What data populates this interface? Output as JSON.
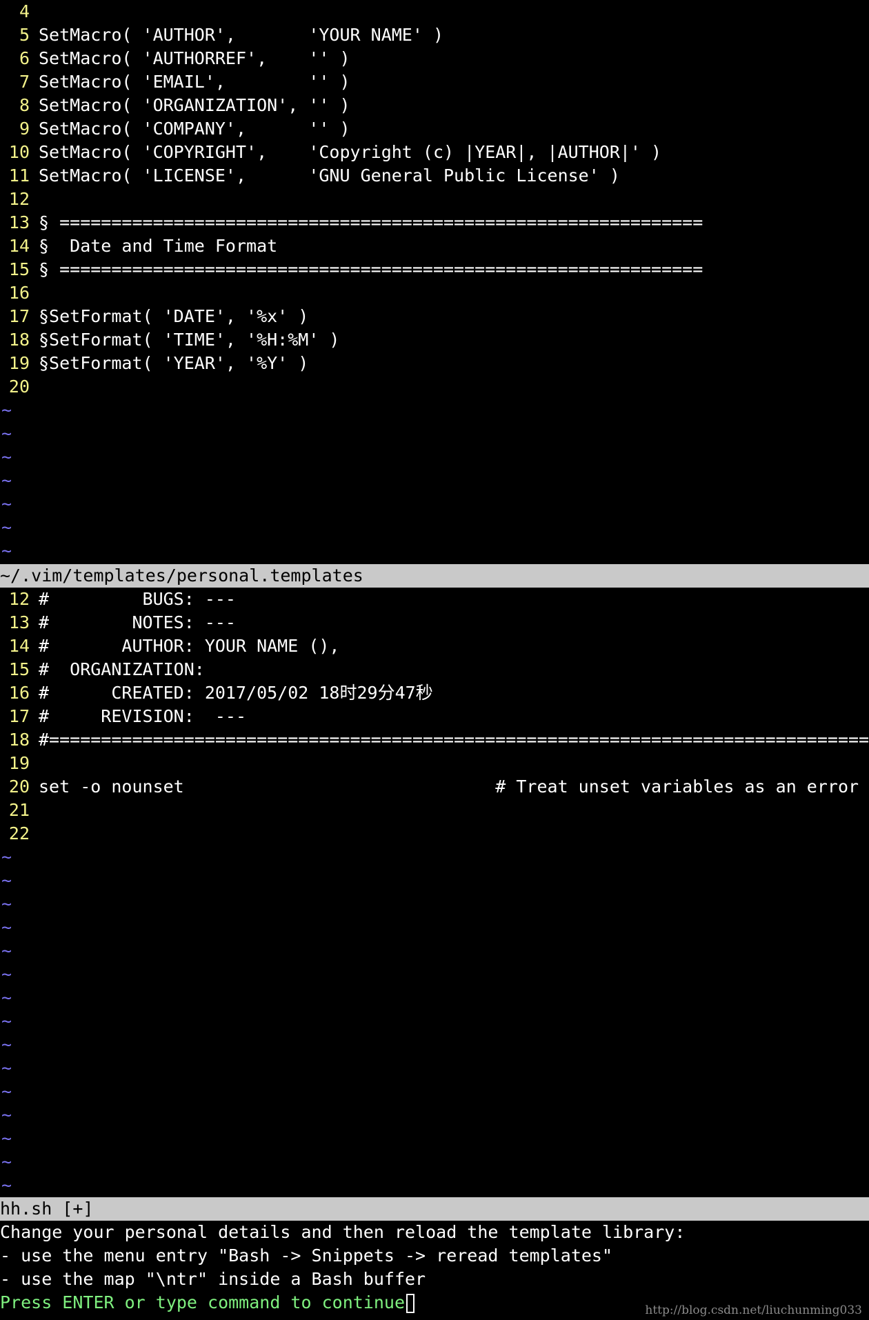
{
  "colors": {
    "background": "#000000",
    "line_number": "#f3f28a",
    "tilde": "#7b73f2",
    "statusline_bg": "#c9c9c9",
    "prompt": "#7ff07f"
  },
  "top_pane": {
    "lines": [
      {
        "num": "4",
        "text": ""
      },
      {
        "num": "5",
        "text": "SetMacro( 'AUTHOR',       'YOUR NAME' )"
      },
      {
        "num": "6",
        "text": "SetMacro( 'AUTHORREF',    '' )"
      },
      {
        "num": "7",
        "text": "SetMacro( 'EMAIL',        '' )"
      },
      {
        "num": "8",
        "text": "SetMacro( 'ORGANIZATION', '' )"
      },
      {
        "num": "9",
        "text": "SetMacro( 'COMPANY',      '' )"
      },
      {
        "num": "10",
        "text": "SetMacro( 'COPYRIGHT',    'Copyright (c) |YEAR|, |AUTHOR|' )"
      },
      {
        "num": "11",
        "text": "SetMacro( 'LICENSE',      'GNU General Public License' )"
      },
      {
        "num": "12",
        "text": ""
      },
      {
        "num": "13",
        "text": "§ =============================================================="
      },
      {
        "num": "14",
        "text": "§  Date and Time Format"
      },
      {
        "num": "15",
        "text": "§ =============================================================="
      },
      {
        "num": "16",
        "text": ""
      },
      {
        "num": "17",
        "text": "§SetFormat( 'DATE', '%x' )"
      },
      {
        "num": "18",
        "text": "§SetFormat( 'TIME', '%H:%M' )"
      },
      {
        "num": "19",
        "text": "§SetFormat( 'YEAR', '%Y' )"
      },
      {
        "num": "20",
        "text": ""
      }
    ],
    "tilde": "~",
    "tilde_count": 7,
    "status": "~/.vim/templates/personal.templates"
  },
  "bottom_pane": {
    "lines": [
      {
        "num": "12",
        "text": "#         BUGS: ---"
      },
      {
        "num": "13",
        "text": "#        NOTES: ---"
      },
      {
        "num": "14",
        "text": "#       AUTHOR: YOUR NAME (),"
      },
      {
        "num": "15",
        "text": "#  ORGANIZATION:"
      },
      {
        "num": "16",
        "text": "#      CREATED: 2017/05/02 18时29分47秒"
      },
      {
        "num": "17",
        "text": "#     REVISION:  ---"
      },
      {
        "num": "18",
        "text": "#==============================================================================="
      },
      {
        "num": "19",
        "text": ""
      },
      {
        "num": "20",
        "text": "set -o nounset                              # Treat unset variables as an error"
      },
      {
        "num": "21",
        "text": ""
      },
      {
        "num": "22",
        "text": ""
      }
    ],
    "tilde": "~",
    "tilde_count": 15,
    "status": "hh.sh [+]"
  },
  "messages": [
    "Change your personal details and then reload the template library:",
    "- use the menu entry \"Bash -> Snippets -> reread templates\"",
    "- use the map \"\\ntr\" inside a Bash buffer"
  ],
  "prompt": "Press ENTER or type command to continue",
  "watermark": "http://blog.csdn.net/liuchunming033"
}
